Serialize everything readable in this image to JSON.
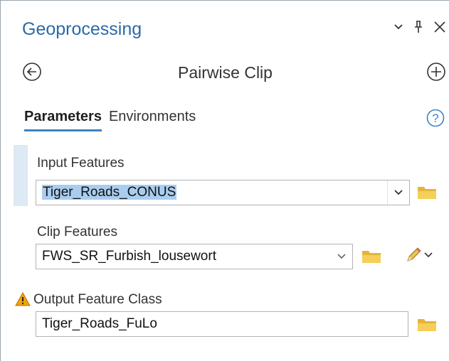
{
  "pane": {
    "title": "Geoprocessing"
  },
  "tool": {
    "title": "Pairwise Clip"
  },
  "tabs": [
    {
      "label": "Parameters",
      "active": true
    },
    {
      "label": "Environments",
      "active": false
    }
  ],
  "icons": {
    "menu": "chevron-down-icon",
    "pin": "pin-icon",
    "close": "close-icon",
    "back": "back-arrow-icon",
    "add": "add-icon",
    "help": "help-icon",
    "browse": "folder-icon",
    "warning": "warning-icon",
    "edit": "pencil-icon"
  },
  "params": {
    "input_features": {
      "label": "Input Features",
      "value": "Tiger_Roads_CONUS"
    },
    "clip_features": {
      "label": "Clip Features",
      "value": "FWS_SR_Furbish_lousewort"
    },
    "output_class": {
      "label": "Output Feature Class",
      "value": "Tiger_Roads_FuLo"
    }
  },
  "colors": {
    "title_blue": "#2b6aa8",
    "tab_underline": "#3b83c4",
    "selection": "#a9cdef",
    "folder": "#f2c44e",
    "warning": "#f0a30a",
    "help_blue": "#3b83c4"
  }
}
